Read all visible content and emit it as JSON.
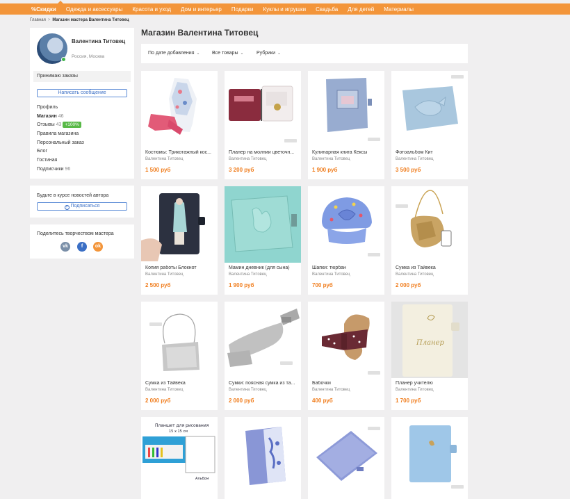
{
  "nav": [
    {
      "label": "%Скидки"
    },
    {
      "label": "Одежда и аксессуары"
    },
    {
      "label": "Красота и уход"
    },
    {
      "label": "Дом и интерьер"
    },
    {
      "label": "Подарки"
    },
    {
      "label": "Куклы и игрушки"
    },
    {
      "label": "Свадьба"
    },
    {
      "label": "Для детей"
    },
    {
      "label": "Материалы"
    }
  ],
  "breadcrumb": {
    "home": "Главная",
    "sep": ">",
    "current": "Магазин мастера Валентина Титовец"
  },
  "profile": {
    "name": "Валентина Титовец",
    "location": "Россия, Москва",
    "orders_label": "Принимаю заказы",
    "message_button": "Написать сообщение",
    "menu": [
      {
        "label": "Профиль",
        "count": ""
      },
      {
        "label": "Магазин",
        "count": "46"
      },
      {
        "label": "Отзывы",
        "count": "43",
        "badge": "+100%"
      },
      {
        "label": "Правила магазина",
        "count": ""
      },
      {
        "label": "Персональный заказ",
        "count": ""
      },
      {
        "label": "Блог",
        "count": ""
      },
      {
        "label": "Гостиная",
        "count": ""
      },
      {
        "label": "Подписчики",
        "count": "96"
      }
    ]
  },
  "news": {
    "text": "Будьте в курсе новостей автора",
    "button": "Подписаться",
    "button_icon": "plus-circle-icon"
  },
  "share": {
    "text": "Поделитесь творчеством мастера",
    "icons": {
      "vk": "vk-icon",
      "fb": "facebook-icon",
      "ok": "odnoklassniki-icon"
    },
    "vk_glyph": "vk",
    "fb_glyph": "f",
    "ok_glyph": "ok"
  },
  "shop_title": "Магазин Валентина Титовец",
  "filters": {
    "sort": "По дате добавления",
    "all": "Все товары",
    "rubrics": "Рубрики"
  },
  "colors": {
    "accent": "#f3953a",
    "price": "#f07d1d",
    "link": "#3b6fc5",
    "badge": "#58b947"
  },
  "products": [
    {
      "name": "Костюмы: Трикотажный кос...",
      "seller": "Валентина Титовец",
      "price": "1 500 руб"
    },
    {
      "name": "Планер на молнии цветочн...",
      "seller": "Валентина Титовец",
      "price": "3 200 руб"
    },
    {
      "name": "Кулинарная книга Кексы",
      "seller": "Валентина Титовец",
      "price": "1 900 руб"
    },
    {
      "name": "Фотоальбом Кит",
      "seller": "Валентина Титовец",
      "price": "3 500 руб"
    },
    {
      "name": "Копия работы Блокнот",
      "seller": "Валентина Титовец",
      "price": "2 500 руб"
    },
    {
      "name": "Мамин дневник (для сына)",
      "seller": "Валентина Титовец",
      "price": "1 900 руб"
    },
    {
      "name": "Шапки: тюрбан",
      "seller": "Валентина Титовец",
      "price": "700 руб"
    },
    {
      "name": "Сумка из Тайвека",
      "seller": "Валентина Титовец",
      "price": "2 000 руб"
    },
    {
      "name": "Сумка из Тайвека",
      "seller": "Валентина Титовец",
      "price": "2 000 руб"
    },
    {
      "name": "Сумки: поясная сумка из та...",
      "seller": "Валентина Титовец",
      "price": "2 000 руб"
    },
    {
      "name": "Бабочки",
      "seller": "Валентина Титовец",
      "price": "400 руб"
    },
    {
      "name": "Планер учителю",
      "seller": "Валентина Титовец",
      "price": "1 700 руб"
    },
    {
      "name": "",
      "seller": "",
      "price": ""
    },
    {
      "name": "",
      "seller": "",
      "price": ""
    },
    {
      "name": "",
      "seller": "",
      "price": ""
    },
    {
      "name": "",
      "seller": "",
      "price": ""
    }
  ],
  "photo_texts": {
    "planner_word": "Планер",
    "tablet_title": "Планшет для рисования",
    "tablet_size": "15 x 15 см",
    "tablet_note": "Альбом"
  }
}
